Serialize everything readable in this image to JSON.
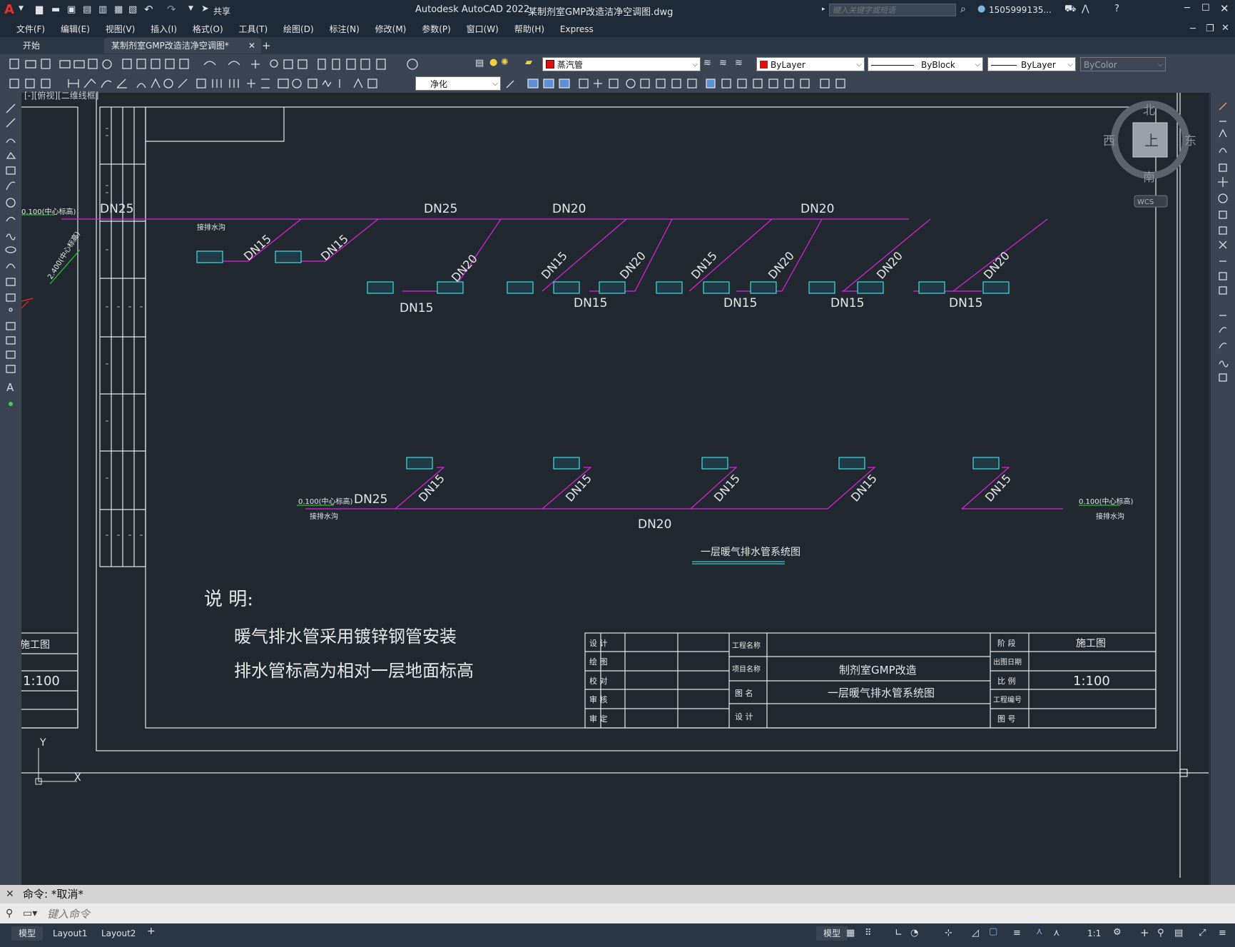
{
  "app": {
    "title": "Autodesk AutoCAD 2022",
    "document": "某制剂室GMP改造洁净空调图.dwg",
    "share_label": "共享",
    "search_placeholder": "键入关键字或短语",
    "user": "1505999135..."
  },
  "menu": [
    "文件(F)",
    "编辑(E)",
    "视图(V)",
    "插入(I)",
    "格式(O)",
    "工具(T)",
    "绘图(D)",
    "标注(N)",
    "修改(M)",
    "参数(P)",
    "窗口(W)",
    "帮助(H)",
    "Express"
  ],
  "tabs": [
    {
      "label": "开始",
      "active": false
    },
    {
      "label": "某制剂室GMP改造洁净空调图*",
      "active": true
    }
  ],
  "properties": {
    "layer": "蒸汽管",
    "color": "ByLayer",
    "linetype": "ByBlock",
    "lineweight": "ByLayer",
    "plotstyle": "ByColor",
    "dimstyle": "净化"
  },
  "viewport_label": "[-][俯视][二维线框]",
  "viewcube": {
    "north": "北",
    "south": "南",
    "east": "东",
    "west": "西",
    "top": "上",
    "wcs": "WCS"
  },
  "drawing": {
    "upper": {
      "left_label": "0.100(中心标高)",
      "left_elev": "2.400(中心标高)",
      "drain_note": "接排水沟",
      "main_sizes": [
        "DN25",
        "DN25",
        "DN20",
        "DN20"
      ],
      "branch_labels": [
        "DN15",
        "DN15",
        "DN20",
        "DN15",
        "DN20",
        "DN15",
        "DN20",
        "DN20",
        "DN20"
      ],
      "bottom_labels": [
        "DN15",
        "DN15",
        "DN15",
        "DN15",
        "DN15"
      ]
    },
    "lower": {
      "left_label": "0.100(中心标高)",
      "left_note": "接排水沟",
      "main_size_left": "DN25",
      "main_size": "DN20",
      "branch_labels": [
        "DN15",
        "DN15",
        "DN15",
        "DN15",
        "DN15"
      ],
      "right_label": "0.100(中心标高)",
      "right_note": "接排水沟"
    },
    "caption": "一层暖气排水管系统图",
    "notes_title": "说   明:",
    "notes": [
      "暖气排水管采用镀锌钢管安装",
      "排水管标高为相对一层地面标高"
    ],
    "left_stamp_stage": "施工图",
    "left_stamp_scale": "1:100",
    "title_block": {
      "sign_rows": [
        "设  计",
        "绘  图",
        "校  对",
        "审  核",
        "审  定"
      ],
      "project_label": "工程名称",
      "item_label": "项目名称",
      "item_value": "制剂室GMP改造",
      "drawing_label": "图  名",
      "drawing_value": "一层暖气排水管系统图",
      "design_label": "设  计",
      "stage_label": "阶  段",
      "stage_value": "施工图",
      "date_label": "出图日期",
      "scale_label": "比  例",
      "scale_value": "1:100",
      "code_label": "工程编号",
      "no_label": "图  号"
    }
  },
  "axes": {
    "y": "Y",
    "x": "X"
  },
  "command": {
    "history": "命令:  *取消*",
    "placeholder": "键入命令"
  },
  "status": {
    "layout_tabs": [
      "模型",
      "Layout1",
      "Layout2"
    ],
    "model": "模型",
    "scale": "1:1"
  },
  "colors": {
    "background": "#212830",
    "pipe": "#e020e0",
    "radiator": "#3ff0f0",
    "leader": "#22c232",
    "frame": "#e8e8e8"
  }
}
